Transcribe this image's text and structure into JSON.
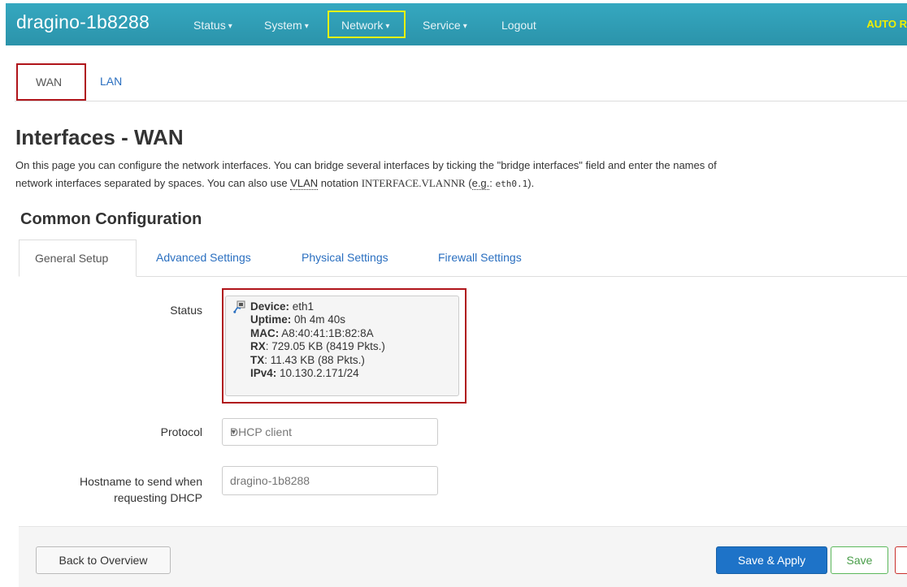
{
  "navbar": {
    "brand": "dragino-1b8288",
    "items": [
      {
        "label": "Status",
        "caret": "▾"
      },
      {
        "label": "System",
        "caret": "▾"
      },
      {
        "label": "Network",
        "caret": "▾"
      },
      {
        "label": "Service",
        "caret": "▾"
      },
      {
        "label": "Logout"
      }
    ],
    "auto_refresh": "AUTO R"
  },
  "top_tabs": [
    {
      "label": "WAN",
      "active": true
    },
    {
      "label": "LAN",
      "active": false
    }
  ],
  "page": {
    "title": "Interfaces - WAN",
    "desc_1": "On this page you can configure the network interfaces. You can bridge several interfaces by ticking the \"bridge interfaces\" field and enter the names of",
    "desc_2a": "network interfaces separated by spaces. You can also use ",
    "desc_vlan": "VLAN",
    "desc_2b": " notation ",
    "desc_notation": "INTERFACE.VLANNR",
    "desc_2c": " (",
    "desc_eg": "e.g.",
    "desc_2d": ": ",
    "desc_code": "eth0.1",
    "desc_2e": ")."
  },
  "section": {
    "title": "Common Configuration",
    "tabs": [
      {
        "label": "General Setup",
        "active": true
      },
      {
        "label": "Advanced Settings"
      },
      {
        "label": "Physical Settings"
      },
      {
        "label": "Firewall Settings"
      }
    ]
  },
  "status": {
    "label": "Status",
    "device_key": "Device:",
    "device_val": " eth1",
    "uptime_key": "Uptime:",
    "uptime_val": " 0h 4m 40s",
    "mac_key": "MAC:",
    "mac_val": " A8:40:41:1B:82:8A",
    "rx_key": "RX",
    "rx_val": ": 729.05 KB (8419 Pkts.)",
    "tx_key": "TX",
    "tx_val": ": 11.43 KB (88 Pkts.)",
    "ipv4_key": "IPv4:",
    "ipv4_val": " 10.130.2.171/24"
  },
  "protocol": {
    "label": "Protocol",
    "value": "DHCP client"
  },
  "hostname": {
    "label_1": "Hostname to send when",
    "label_2": "requesting DHCP",
    "placeholder": "dragino-1b8288"
  },
  "actions": {
    "back": "Back to Overview",
    "save_apply": "Save & Apply",
    "save": "Save"
  },
  "colors": {
    "navbar": "#2f9eb6",
    "link": "#2a6fc0",
    "primary": "#1e73c8",
    "highlight_red": "#b0141a",
    "highlight_yellow": "#e8f100"
  }
}
